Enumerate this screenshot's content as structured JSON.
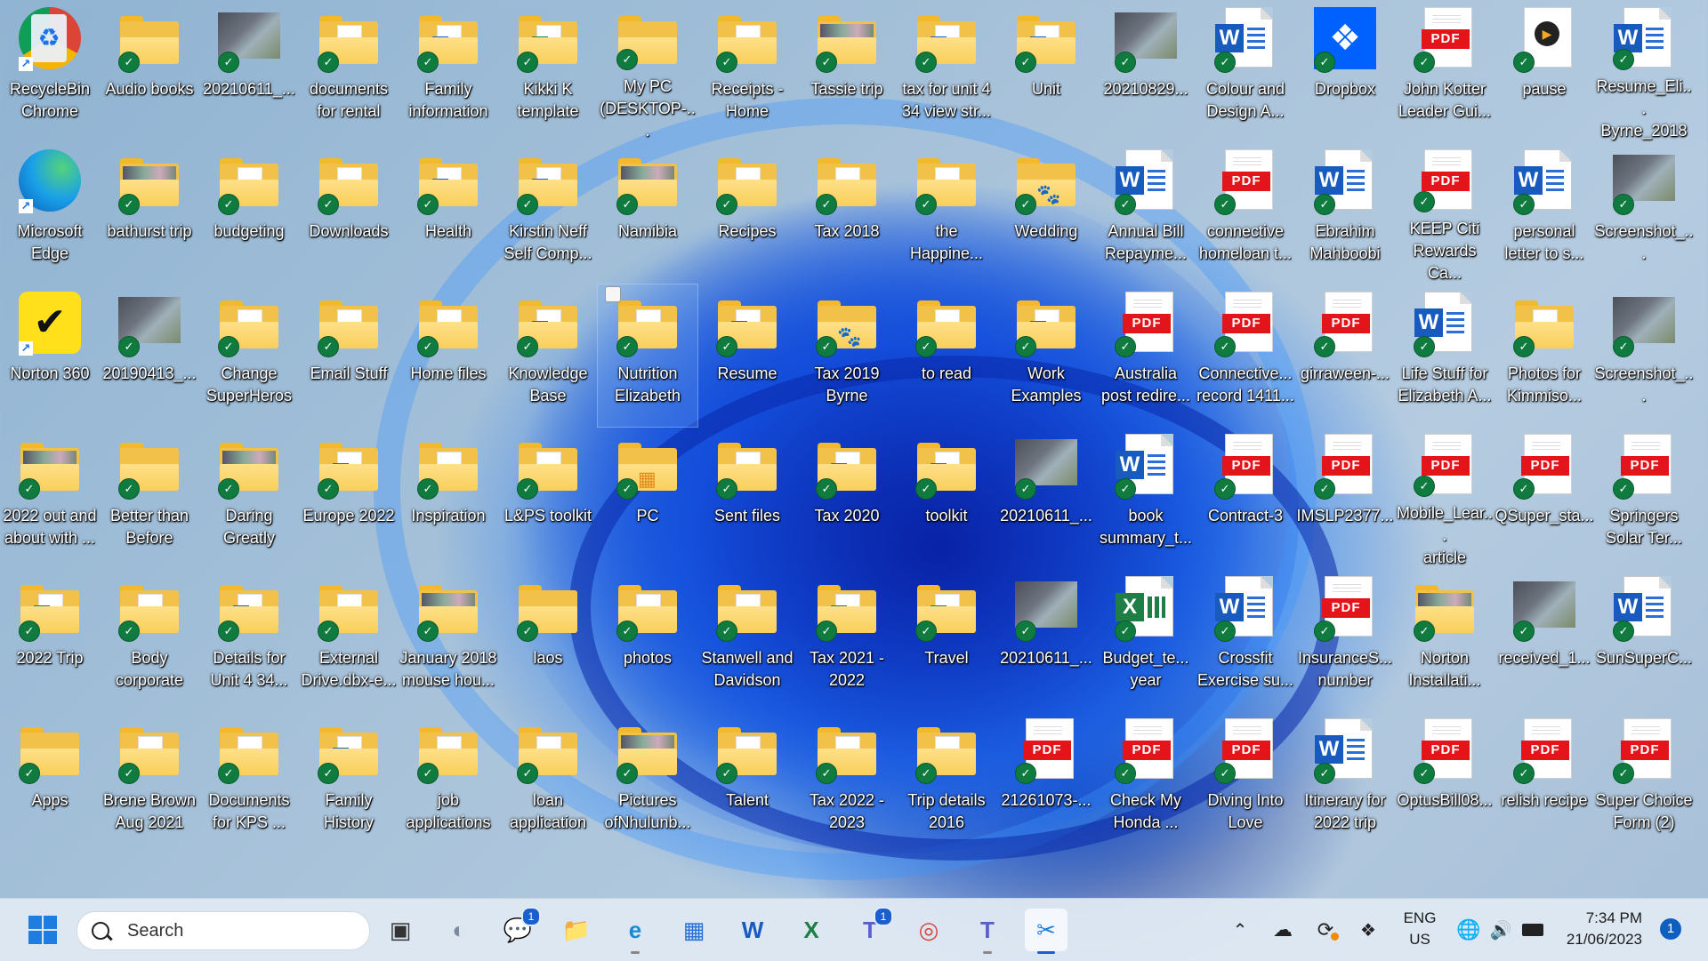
{
  "desktop": {
    "columns": [
      [
        {
          "label": "RecycleBin\nChrome",
          "type": "app",
          "app": "recycle-bin",
          "shortcut": true
        },
        {
          "label": "Microsoft\nEdge",
          "type": "app",
          "app": "edge",
          "shortcut": true
        },
        {
          "label": "Norton 360",
          "type": "app",
          "app": "norton",
          "shortcut": true
        },
        {
          "label": "2022 out and\nabout with ...",
          "type": "folder",
          "content": "photo",
          "synced": true
        },
        {
          "label": "2022 Trip",
          "type": "folder",
          "content": "excel",
          "synced": true
        },
        {
          "label": "Apps",
          "type": "folder",
          "content": "empty",
          "synced": true
        }
      ],
      [
        {
          "label": "Audio books",
          "type": "folder",
          "content": "empty",
          "synced": true
        },
        {
          "label": "bathurst trip",
          "type": "folder",
          "content": "photo",
          "synced": true
        },
        {
          "label": "20190413_...",
          "type": "image",
          "synced": true
        },
        {
          "label": "Better than\nBefore",
          "type": "folder",
          "content": "empty",
          "synced": true
        },
        {
          "label": "Body\ncorporate",
          "type": "folder",
          "content": "pdf",
          "synced": true
        },
        {
          "label": "Brene Brown\nAug 2021",
          "type": "folder",
          "content": "pdf",
          "synced": true
        }
      ],
      [
        {
          "label": "20210611_...",
          "type": "image",
          "synced": true
        },
        {
          "label": "budgeting",
          "type": "folder",
          "content": "pdf",
          "synced": true
        },
        {
          "label": "Change\nSuperHeros",
          "type": "folder",
          "content": "pdf",
          "synced": true
        },
        {
          "label": "Daring\nGreatly",
          "type": "folder",
          "content": "photo",
          "synced": true
        },
        {
          "label": "Details for\nUnit 4 34...",
          "type": "folder",
          "content": "word",
          "synced": true
        },
        {
          "label": "Documents\nfor KPS ...",
          "type": "folder",
          "content": "pdf",
          "synced": true
        }
      ],
      [
        {
          "label": "documents\nfor rental",
          "type": "folder",
          "content": "doc",
          "synced": true
        },
        {
          "label": "Downloads",
          "type": "folder",
          "content": "pdf",
          "synced": true
        },
        {
          "label": "Email Stuff",
          "type": "folder",
          "content": "doc",
          "synced": true
        },
        {
          "label": "Europe 2022",
          "type": "folder",
          "content": "word",
          "synced": true
        },
        {
          "label": "External\nDrive.dbx-e...",
          "type": "folder",
          "content": "doc",
          "synced": true
        },
        {
          "label": "Family\nHistory",
          "type": "folder",
          "content": "word",
          "synced": true
        }
      ],
      [
        {
          "label": "Family\ninformation",
          "type": "folder",
          "content": "word",
          "synced": true
        },
        {
          "label": "Health",
          "type": "folder",
          "content": "word",
          "synced": true
        },
        {
          "label": "Home files",
          "type": "folder",
          "content": "pdf",
          "synced": true
        },
        {
          "label": "Inspiration",
          "type": "folder",
          "content": "pdf",
          "synced": true
        },
        {
          "label": "January 2018\nmouse hou...",
          "type": "folder",
          "content": "photo",
          "synced": true
        },
        {
          "label": "job\napplications",
          "type": "folder",
          "content": "doc",
          "synced": true
        }
      ],
      [
        {
          "label": "Kikki K\ntemplate",
          "type": "folder",
          "content": "excel",
          "synced": true
        },
        {
          "label": "Kirstin Neff\nSelf Comp...",
          "type": "folder",
          "content": "word",
          "synced": true
        },
        {
          "label": "Knowledge\nBase",
          "type": "folder",
          "content": "word",
          "synced": true
        },
        {
          "label": "L&PS toolkit",
          "type": "folder",
          "content": "pdf",
          "synced": true
        },
        {
          "label": "laos",
          "type": "folder",
          "content": "empty",
          "synced": true
        },
        {
          "label": "loan\napplication",
          "type": "folder",
          "content": "pdf",
          "synced": true
        }
      ],
      [
        {
          "label": "My PC\n(DESKTOP-...",
          "type": "folder",
          "content": "empty",
          "synced": true
        },
        {
          "label": "Namibia",
          "type": "folder",
          "content": "photo",
          "synced": true
        },
        {
          "label": "Nutrition\nElizabeth",
          "type": "folder",
          "content": "pdf",
          "synced": true,
          "selected": true
        },
        {
          "label": "PC",
          "type": "folder",
          "content": "windows",
          "synced": true
        },
        {
          "label": "photos",
          "type": "folder",
          "content": "doc",
          "synced": true
        },
        {
          "label": "Pictures\nofNhulunb...",
          "type": "folder",
          "content": "photo",
          "synced": true
        }
      ],
      [
        {
          "label": "Receipts -\nHome",
          "type": "folder",
          "content": "pdf",
          "synced": true
        },
        {
          "label": "Recipes",
          "type": "folder",
          "content": "pdf",
          "synced": true
        },
        {
          "label": "Resume",
          "type": "folder",
          "content": "word",
          "synced": true
        },
        {
          "label": "Sent files",
          "type": "folder",
          "content": "pdf",
          "synced": true
        },
        {
          "label": "Stanwell and\nDavidson",
          "type": "folder",
          "content": "pdf",
          "synced": true
        },
        {
          "label": "Talent",
          "type": "folder",
          "content": "pdf",
          "synced": true
        }
      ],
      [
        {
          "label": "Tassie trip",
          "type": "folder",
          "content": "photo",
          "synced": true
        },
        {
          "label": "Tax 2018",
          "type": "folder",
          "content": "pdf",
          "synced": true
        },
        {
          "label": "Tax 2019\nByrne",
          "type": "folder",
          "content": "paw",
          "synced": true
        },
        {
          "label": "Tax 2020",
          "type": "folder",
          "content": "excel",
          "synced": true
        },
        {
          "label": "Tax 2021 -\n2022",
          "type": "folder",
          "content": "excel",
          "synced": true
        },
        {
          "label": "Tax 2022 -\n2023",
          "type": "folder",
          "content": "pdf",
          "synced": true
        }
      ],
      [
        {
          "label": "tax for unit 4\n34 view str...",
          "type": "folder",
          "content": "word",
          "synced": true
        },
        {
          "label": "the\nHappine...",
          "type": "folder",
          "content": "pdf",
          "synced": true
        },
        {
          "label": "to read",
          "type": "folder",
          "content": "pdf",
          "synced": true
        },
        {
          "label": "toolkit",
          "type": "folder",
          "content": "excel",
          "synced": true
        },
        {
          "label": "Travel",
          "type": "folder",
          "content": "excel",
          "synced": true
        },
        {
          "label": "Trip details\n2016",
          "type": "folder",
          "content": "pdf",
          "synced": true
        }
      ],
      [
        {
          "label": "Unit",
          "type": "folder",
          "content": "word",
          "synced": true
        },
        {
          "label": "Wedding",
          "type": "folder",
          "content": "paw",
          "synced": true
        },
        {
          "label": "Work\nExamples",
          "type": "folder",
          "content": "word",
          "synced": true
        },
        {
          "label": "20210611_...",
          "type": "image",
          "synced": true
        },
        {
          "label": "20210611_...",
          "type": "image",
          "synced": true
        },
        {
          "label": "21261073-...",
          "type": "pdf",
          "synced": true
        }
      ],
      [
        {
          "label": "20210829...",
          "type": "image",
          "synced": true
        },
        {
          "label": "Annual Bill\nRepayme...",
          "type": "word",
          "synced": true
        },
        {
          "label": "Australia\npost  redire...",
          "type": "pdf",
          "synced": true
        },
        {
          "label": "book\nsummary_t...",
          "type": "word",
          "synced": true
        },
        {
          "label": "Budget_te...\nyear",
          "type": "excel",
          "synced": true
        },
        {
          "label": "Check My\nHonda ...",
          "type": "pdf",
          "synced": true
        }
      ],
      [
        {
          "label": "Colour and\nDesign A...",
          "type": "word",
          "synced": true
        },
        {
          "label": "connective\nhomeloan t...",
          "type": "pdf",
          "synced": true
        },
        {
          "label": "Connective...\nrecord 1411...",
          "type": "pdf",
          "synced": true
        },
        {
          "label": "Contract-3",
          "type": "pdf",
          "synced": true
        },
        {
          "label": "Crossfit\nExercise su...",
          "type": "word",
          "synced": true
        },
        {
          "label": "Diving Into\nLove",
          "type": "pdf",
          "synced": true
        }
      ],
      [
        {
          "label": "Dropbox",
          "type": "app",
          "app": "dropbox",
          "synced": true
        },
        {
          "label": "Ebrahim\nMahboobi",
          "type": "word",
          "synced": true
        },
        {
          "label": "girraween-...",
          "type": "pdf",
          "synced": true
        },
        {
          "label": "IMSLP2377...",
          "type": "pdf",
          "synced": true
        },
        {
          "label": "InsuranceS...\nnumber",
          "type": "pdf",
          "synced": true
        },
        {
          "label": "Itinerary for\n2022 trip",
          "type": "word",
          "synced": true
        }
      ],
      [
        {
          "label": "John Kotter\nLeader Gui...",
          "type": "pdf",
          "synced": true
        },
        {
          "label": "KEEP Citi\nRewards Ca...",
          "type": "pdf",
          "synced": true
        },
        {
          "label": "Life Stuff for\nElizabeth A...",
          "type": "word",
          "synced": true
        },
        {
          "label": "Mobile_Lear...\narticle",
          "type": "pdf",
          "synced": true
        },
        {
          "label": "Norton\nInstallati...",
          "type": "folder",
          "content": "photo",
          "synced": true
        },
        {
          "label": "OptusBill08...",
          "type": "pdf",
          "synced": true
        }
      ],
      [
        {
          "label": "pause",
          "type": "app",
          "app": "media",
          "synced": true
        },
        {
          "label": "personal\nletter to s...",
          "type": "word",
          "synced": true
        },
        {
          "label": "Photos for\nKimmiso...",
          "type": "folder",
          "content": "doc",
          "synced": true
        },
        {
          "label": "QSuper_sta...",
          "type": "pdf",
          "synced": true
        },
        {
          "label": "received_1...",
          "type": "image",
          "synced": true
        },
        {
          "label": "relish recipe",
          "type": "pdf",
          "synced": true
        }
      ],
      [
        {
          "label": "Resume_Eli...\nByrne_2018",
          "type": "word",
          "synced": true
        },
        {
          "label": "Screenshot_...",
          "type": "image",
          "synced": true
        },
        {
          "label": "Screenshot_...",
          "type": "image",
          "synced": true
        },
        {
          "label": "Springers\nSolar Ter...",
          "type": "pdf",
          "synced": true
        },
        {
          "label": "SunSuperC...",
          "type": "word",
          "synced": true
        },
        {
          "label": "Super Choice\nForm (2)",
          "type": "pdf",
          "synced": true
        }
      ]
    ]
  },
  "taskbar": {
    "start_icon": "windows-start-icon",
    "search_placeholder": "Search",
    "pinned": [
      {
        "name": "task-view",
        "glyph": "▣"
      },
      {
        "name": "copilot",
        "glyph": "◐"
      },
      {
        "name": "chat",
        "glyph": "💬",
        "badge": "1"
      },
      {
        "name": "file-explorer",
        "glyph": "📁"
      },
      {
        "name": "microsoft-edge",
        "glyph": "e"
      },
      {
        "name": "microsoft-store",
        "glyph": "▦"
      },
      {
        "name": "word",
        "glyph": "W"
      },
      {
        "name": "excel",
        "glyph": "X"
      },
      {
        "name": "teams-classic",
        "glyph": "T",
        "badge": "1"
      },
      {
        "name": "chrome",
        "glyph": "◎"
      },
      {
        "name": "teams",
        "glyph": "T"
      },
      {
        "name": "snipping-tool",
        "glyph": "✂",
        "active": true
      }
    ],
    "tray": {
      "language_line1": "ENG",
      "language_line2": "US",
      "time": "7:34 PM",
      "date": "21/06/2023",
      "notification_count": "1"
    }
  }
}
